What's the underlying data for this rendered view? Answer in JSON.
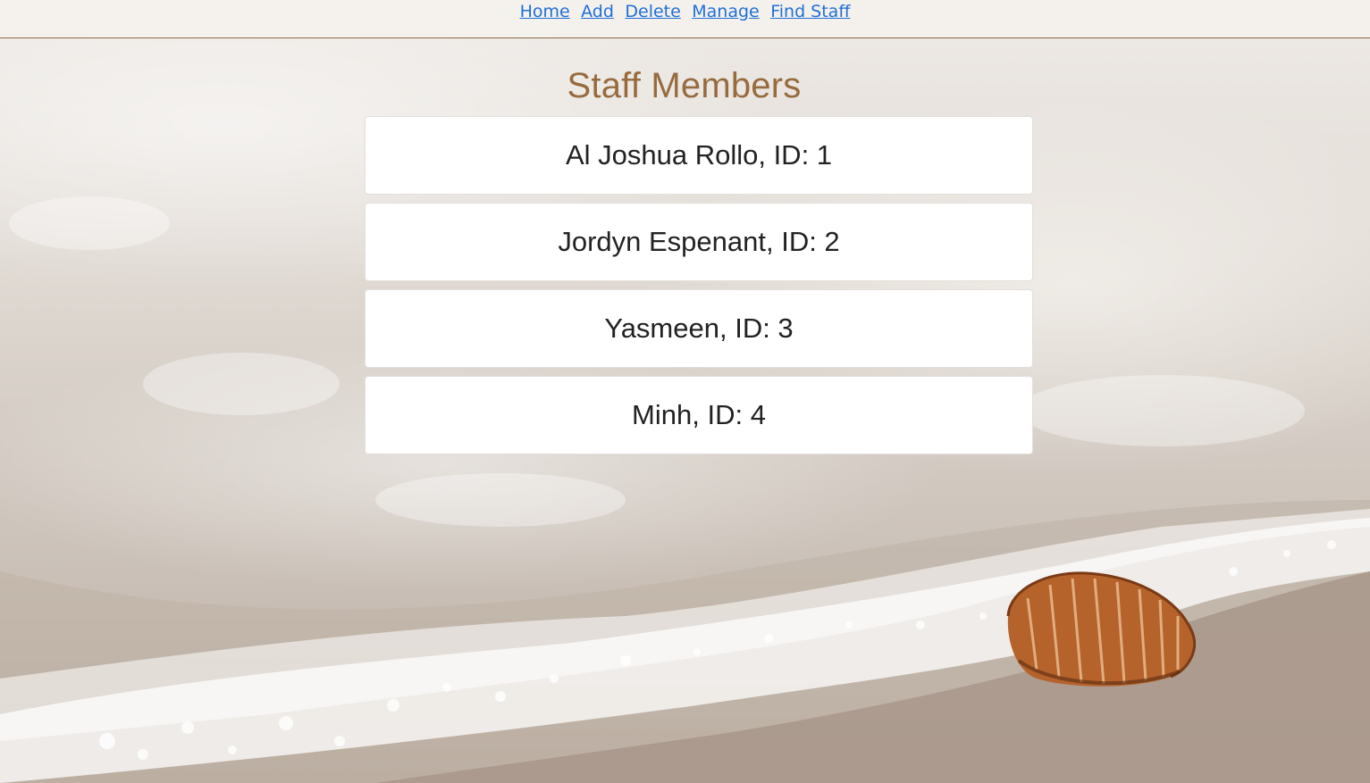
{
  "nav": {
    "links": [
      "Home",
      "Add",
      "Delete",
      "Manage",
      "Find Staff"
    ]
  },
  "page": {
    "title": "Staff Members"
  },
  "staff": [
    "Al Joshua Rollo, ID: 1",
    "Jordyn Espenant, ID: 2",
    "Yasmeen, ID: 3",
    "Minh, ID: 4"
  ],
  "colors": {
    "link": "#1f6fd6",
    "title": "#976b3e",
    "nav_border": "#8a6a4a"
  }
}
